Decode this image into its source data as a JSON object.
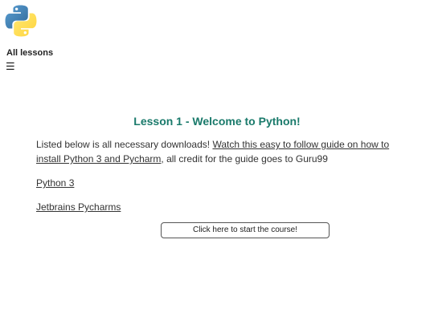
{
  "header": {
    "logo_icon": "python-logo-icon",
    "nav_link": "All lessons",
    "menu_icon_glyph": "☰"
  },
  "lesson": {
    "title": "Lesson 1 - Welcome to Python!",
    "intro_text": "Listed below is all necessary downloads! ",
    "guide_link": "Watch this easy to follow guide on how to install Python 3 and Pycharm",
    "credit_text": ", all credit for the guide goes to Guru99",
    "downloads": [
      {
        "label": "Python 3"
      },
      {
        "label": "Jetbrains Pycharms"
      }
    ],
    "start_button": "Click here to start the course!"
  },
  "colors": {
    "title": "#1a7a6b",
    "python_blue": "#3776ab",
    "python_yellow": "#ffd43b"
  }
}
